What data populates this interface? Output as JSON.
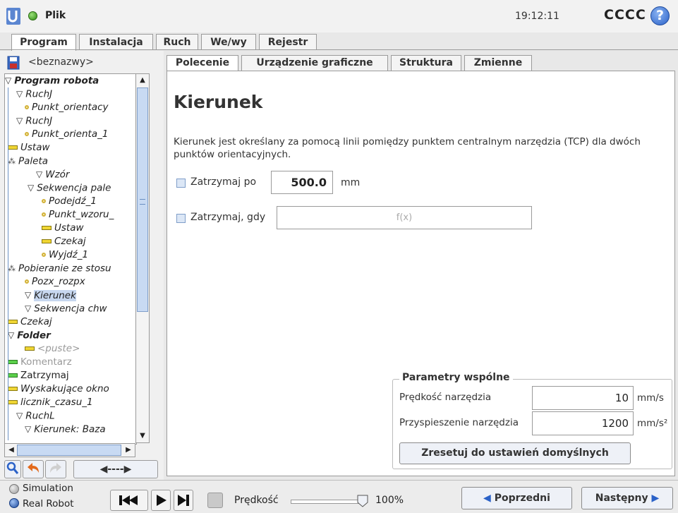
{
  "title_bar": {
    "file_label": "Plik",
    "clock": "19:12:11",
    "robot_name": "CCCC",
    "help_glyph": "?"
  },
  "top_tabs": [
    "Program",
    "Instalacja",
    "Ruch",
    "We/wy",
    "Rejestr"
  ],
  "left_pane": {
    "filename": "<beznazwy>",
    "tree": [
      {
        "label": "Program robota",
        "style": "bold",
        "icon": "triangle-down-icon"
      },
      {
        "label": "RuchJ",
        "icon": "triangle-down-icon"
      },
      {
        "label": "Punkt_orientacy",
        "icon": "waypoint-dot-icon"
      },
      {
        "label": "RuchJ",
        "icon": "triangle-down-icon"
      },
      {
        "label": "Punkt_orienta_1",
        "icon": "waypoint-dot-icon"
      },
      {
        "label": "Ustaw",
        "icon": "yellow-bar-icon"
      },
      {
        "label": "Paleta",
        "icon": "pallet-icon"
      },
      {
        "label": "Wzór",
        "icon": "triangle-down-icon"
      },
      {
        "label": "Sekwencja pale",
        "icon": "triangle-down-icon"
      },
      {
        "label": "Podejdź_1",
        "icon": "waypoint-dot-icon"
      },
      {
        "label": "Punkt_wzoru_",
        "icon": "waypoint-dot-icon"
      },
      {
        "label": "Ustaw",
        "icon": "yellow-bar-icon"
      },
      {
        "label": "Czekaj",
        "icon": "yellow-bar-icon"
      },
      {
        "label": "Wyjdź_1",
        "icon": "waypoint-dot-icon"
      },
      {
        "label": "Pobieranie ze stosu",
        "icon": "pallet-icon"
      },
      {
        "label": "Pozx_rozpx",
        "icon": "waypoint-dot-icon"
      },
      {
        "label": "Kierunek",
        "icon": "triangle-down-icon",
        "selected": true
      },
      {
        "label": "Sekwencja chw",
        "icon": "triangle-down-icon"
      },
      {
        "label": "Czekaj",
        "icon": "yellow-bar-icon"
      },
      {
        "label": "Folder",
        "style": "bold",
        "icon": "triangle-down-icon"
      },
      {
        "label": "<puste>",
        "style": "gray",
        "icon": "yellow-bar-icon"
      },
      {
        "label": "Komentarz",
        "style": "plain-gray",
        "icon": "green-bar-icon"
      },
      {
        "label": "Zatrzymaj",
        "style": "plain",
        "icon": "green-bar-icon"
      },
      {
        "label": "Wyskakujące okno",
        "icon": "yellow-bar-icon"
      },
      {
        "label": "licznik_czasu_1",
        "icon": "yellow-bar-icon"
      },
      {
        "label": "RuchL",
        "icon": "triangle-down-icon"
      },
      {
        "label": "Kierunek: Baza",
        "icon": "triangle-down-icon"
      }
    ],
    "speed_arrow": "◀----▶"
  },
  "sub_tabs": [
    "Polecenie",
    "Urządzenie graficzne",
    "Struktura",
    "Zmienne"
  ],
  "command": {
    "title": "Kierunek",
    "description": "Kierunek jest określany za pomocą linii pomiędzy punktem centralnym narzędzia (TCP) dla dwóch punktów orientacyjnych.",
    "stop_after_label": "Zatrzymaj po",
    "stop_after_value": "500.0",
    "stop_after_unit": "mm",
    "stop_when_label": "Zatrzymaj, gdy",
    "stop_when_placeholder": "f(x)"
  },
  "params": {
    "title": "Parametry wspólne",
    "speed_label": "Prędkość narzędzia",
    "speed_value": "10",
    "speed_unit": "mm/s",
    "accel_label": "Przyspieszenie narzędzia",
    "accel_value": "1200",
    "accel_unit": "mm/s²",
    "reset_label": "Zresetuj do ustawień domyślnych"
  },
  "footer": {
    "simulation_label": "Simulation",
    "real_robot_label": "Real Robot",
    "speed_label": "Prędkość",
    "speed_percent": "100%",
    "speed_fraction": 1.0,
    "prev_label": "Poprzedni",
    "next_label": "Następny"
  },
  "colors": {
    "accent_blue": "#2b62c8",
    "status_green": "#2d8a12",
    "selection": "#c7d7ef"
  }
}
